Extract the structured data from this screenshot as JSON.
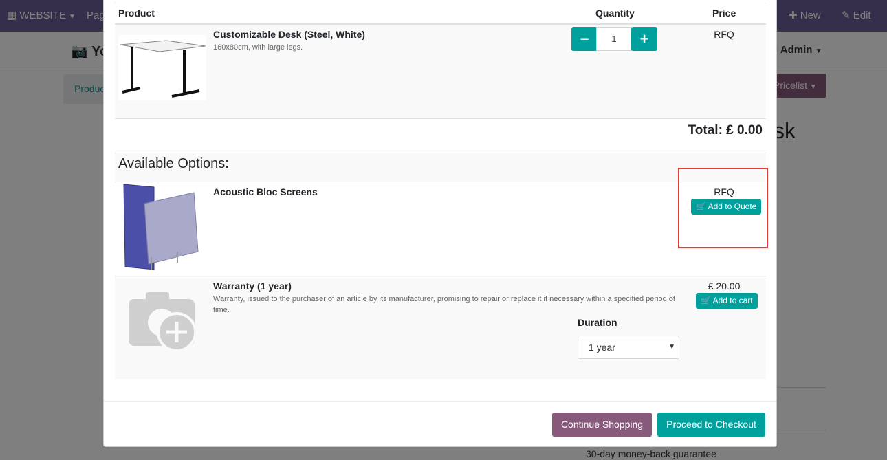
{
  "topbar": {
    "website_label": "WEBSITE",
    "pages_label": "Pag",
    "new_label": "New",
    "edit_label": "Edit"
  },
  "background": {
    "title": "Yo",
    "admin": "l Admin",
    "crumb": "Produc",
    "pricelist": "Pricelist",
    "product_title_fragment": "sk",
    "guarantee": "30-day money-back guarantee"
  },
  "table": {
    "headers": {
      "product": "Product",
      "quantity": "Quantity",
      "price": "Price"
    }
  },
  "cart_item": {
    "name": "Customizable Desk (Steel, White)",
    "description": "160x80cm, with large legs.",
    "quantity": "1",
    "price": "RFQ"
  },
  "total": "Total: £ 0.00",
  "available_options": {
    "heading": "Available Options:",
    "items": [
      {
        "name": "Acoustic Bloc Screens",
        "description": "",
        "price": "RFQ",
        "button": "Add to Quote"
      },
      {
        "name": "Warranty (1 year)",
        "description": "Warranty, issued to the purchaser of an article by its manufacturer, promising to repair or replace it if necessary within a specified period of time.",
        "price": "£ 20.00",
        "button": "Add to cart",
        "duration_label": "Duration",
        "duration_value": "1 year"
      }
    ]
  },
  "footer": {
    "continue_label": "Continue Shopping",
    "checkout_label": "Proceed to Checkout"
  },
  "colors": {
    "primary": "#00a09d",
    "secondary": "#875a7b",
    "topbar": "#6c5f96",
    "highlight": "#e53935"
  }
}
